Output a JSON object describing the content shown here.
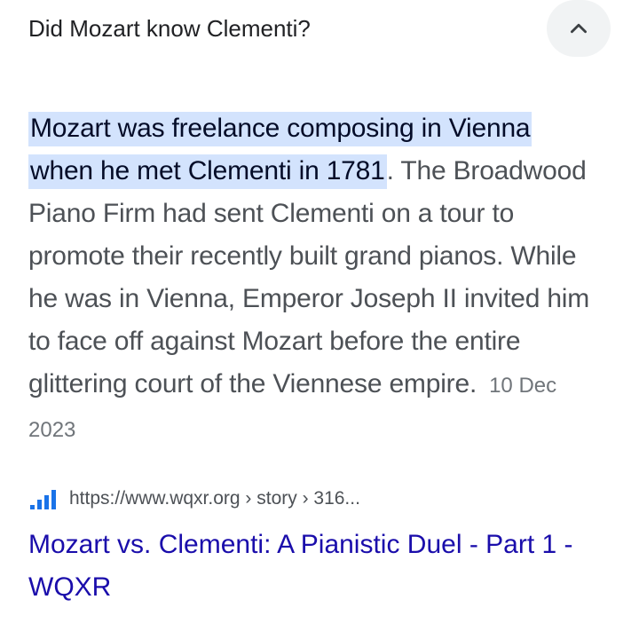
{
  "question": {
    "text": "Did Mozart know Clementi?",
    "toggle_icon": "chevron-up-icon"
  },
  "answer": {
    "highlight_line1": "Mozart was freelance composing in Vienna",
    "highlight_line2": "when he met Clementi in 1781",
    "body": ". The Broadwood Piano Firm had sent Clementi on a tour to promote their recently built grand pianos. While he was in Vienna, Emperor Joseph II invited him to face off against Mozart before the entire glittering court of the Viennese empire.",
    "date": "10 Dec 2023"
  },
  "source": {
    "icon": "wqxr-bars-icon",
    "url": "https://www.wqxr.org › story › 316...",
    "title": "Mozart vs. Clementi: A Pianistic Duel - Part 1 - WQXR"
  },
  "colors": {
    "highlight": "#d3e3fd",
    "link": "#1a0dab",
    "icon_blue": "#1a73e8"
  }
}
